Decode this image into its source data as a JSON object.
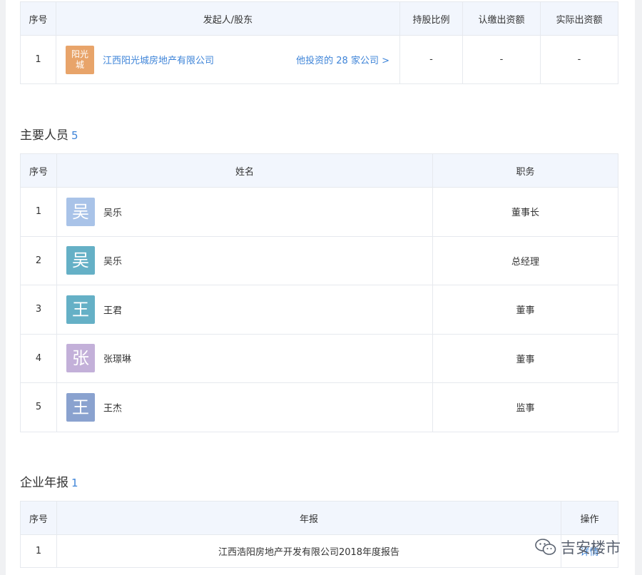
{
  "shareholders": {
    "headers": [
      "序号",
      "发起人/股东",
      "持股比例",
      "认缴出资额",
      "实际出资额"
    ],
    "rows": [
      {
        "index": "1",
        "logo_text": "阳光城",
        "logo_color": "#e8a46a",
        "name": "江西阳光城房地产有限公司",
        "invest_link": "他投资的 28 家公司 >",
        "ratio": "-",
        "subscribed": "-",
        "paid": "-"
      }
    ]
  },
  "personnel": {
    "title": "主要人员",
    "count": "5",
    "headers": [
      "序号",
      "姓名",
      "职务"
    ],
    "rows": [
      {
        "index": "1",
        "avatar": "吴",
        "avatar_color": "#a9c3e8",
        "name": "吴乐",
        "position": "董事长"
      },
      {
        "index": "2",
        "avatar": "吴",
        "avatar_color": "#65b0c6",
        "name": "吴乐",
        "position": "总经理"
      },
      {
        "index": "3",
        "avatar": "王",
        "avatar_color": "#65b0c6",
        "name": "王君",
        "position": "董事"
      },
      {
        "index": "4",
        "avatar": "张",
        "avatar_color": "#c3b0d9",
        "name": "张璟琳",
        "position": "董事"
      },
      {
        "index": "5",
        "avatar": "王",
        "avatar_color": "#8aa2cf",
        "name": "王杰",
        "position": "监事"
      }
    ]
  },
  "reports": {
    "title": "企业年报",
    "count": "1",
    "headers": [
      "序号",
      "年报",
      "操作"
    ],
    "rows": [
      {
        "index": "1",
        "name": "江西浩阳房地产开发有限公司2018年度报告",
        "action": "详情"
      }
    ]
  },
  "watermark": {
    "icon": "wechat-icon",
    "text": "吉安楼市"
  },
  "colors": {
    "link": "#3e84d8",
    "header_bg": "#f2f6fd",
    "border": "#e6e9ee"
  }
}
